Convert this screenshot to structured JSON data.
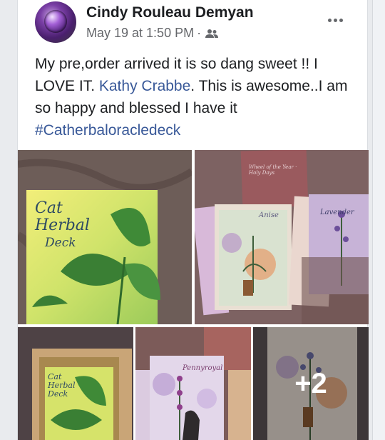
{
  "post": {
    "author": "Cindy Rouleau Demyan",
    "timestamp": "May 19 at 1:50 PM",
    "separator": "·",
    "audience_icon": "group-icon",
    "more_icon": "more-options-icon",
    "text_before": "My pre,order arrived it is so dang sweet !! I LOVE IT.  ",
    "mention": "Kathy Crabbe",
    "text_after": ". This is awesome..I am so happy and blessed I have it",
    "hashtag": "#Catherbaloracledeck"
  },
  "photos": {
    "box_title": "Cat Herbal Deck",
    "box_title_line1": "Cat",
    "box_title_line2": "Herbal",
    "box_title_line3": "Deck",
    "card_wheel": "Wheel of the Year · Holy Days",
    "card_anise": "Anise",
    "card_lavender": "Lavender",
    "card_pennyroyal": "Pennyroyal",
    "more_count": "+2"
  },
  "colors": {
    "link": "#385898",
    "text": "#1c1e21",
    "meta": "#65676b"
  }
}
